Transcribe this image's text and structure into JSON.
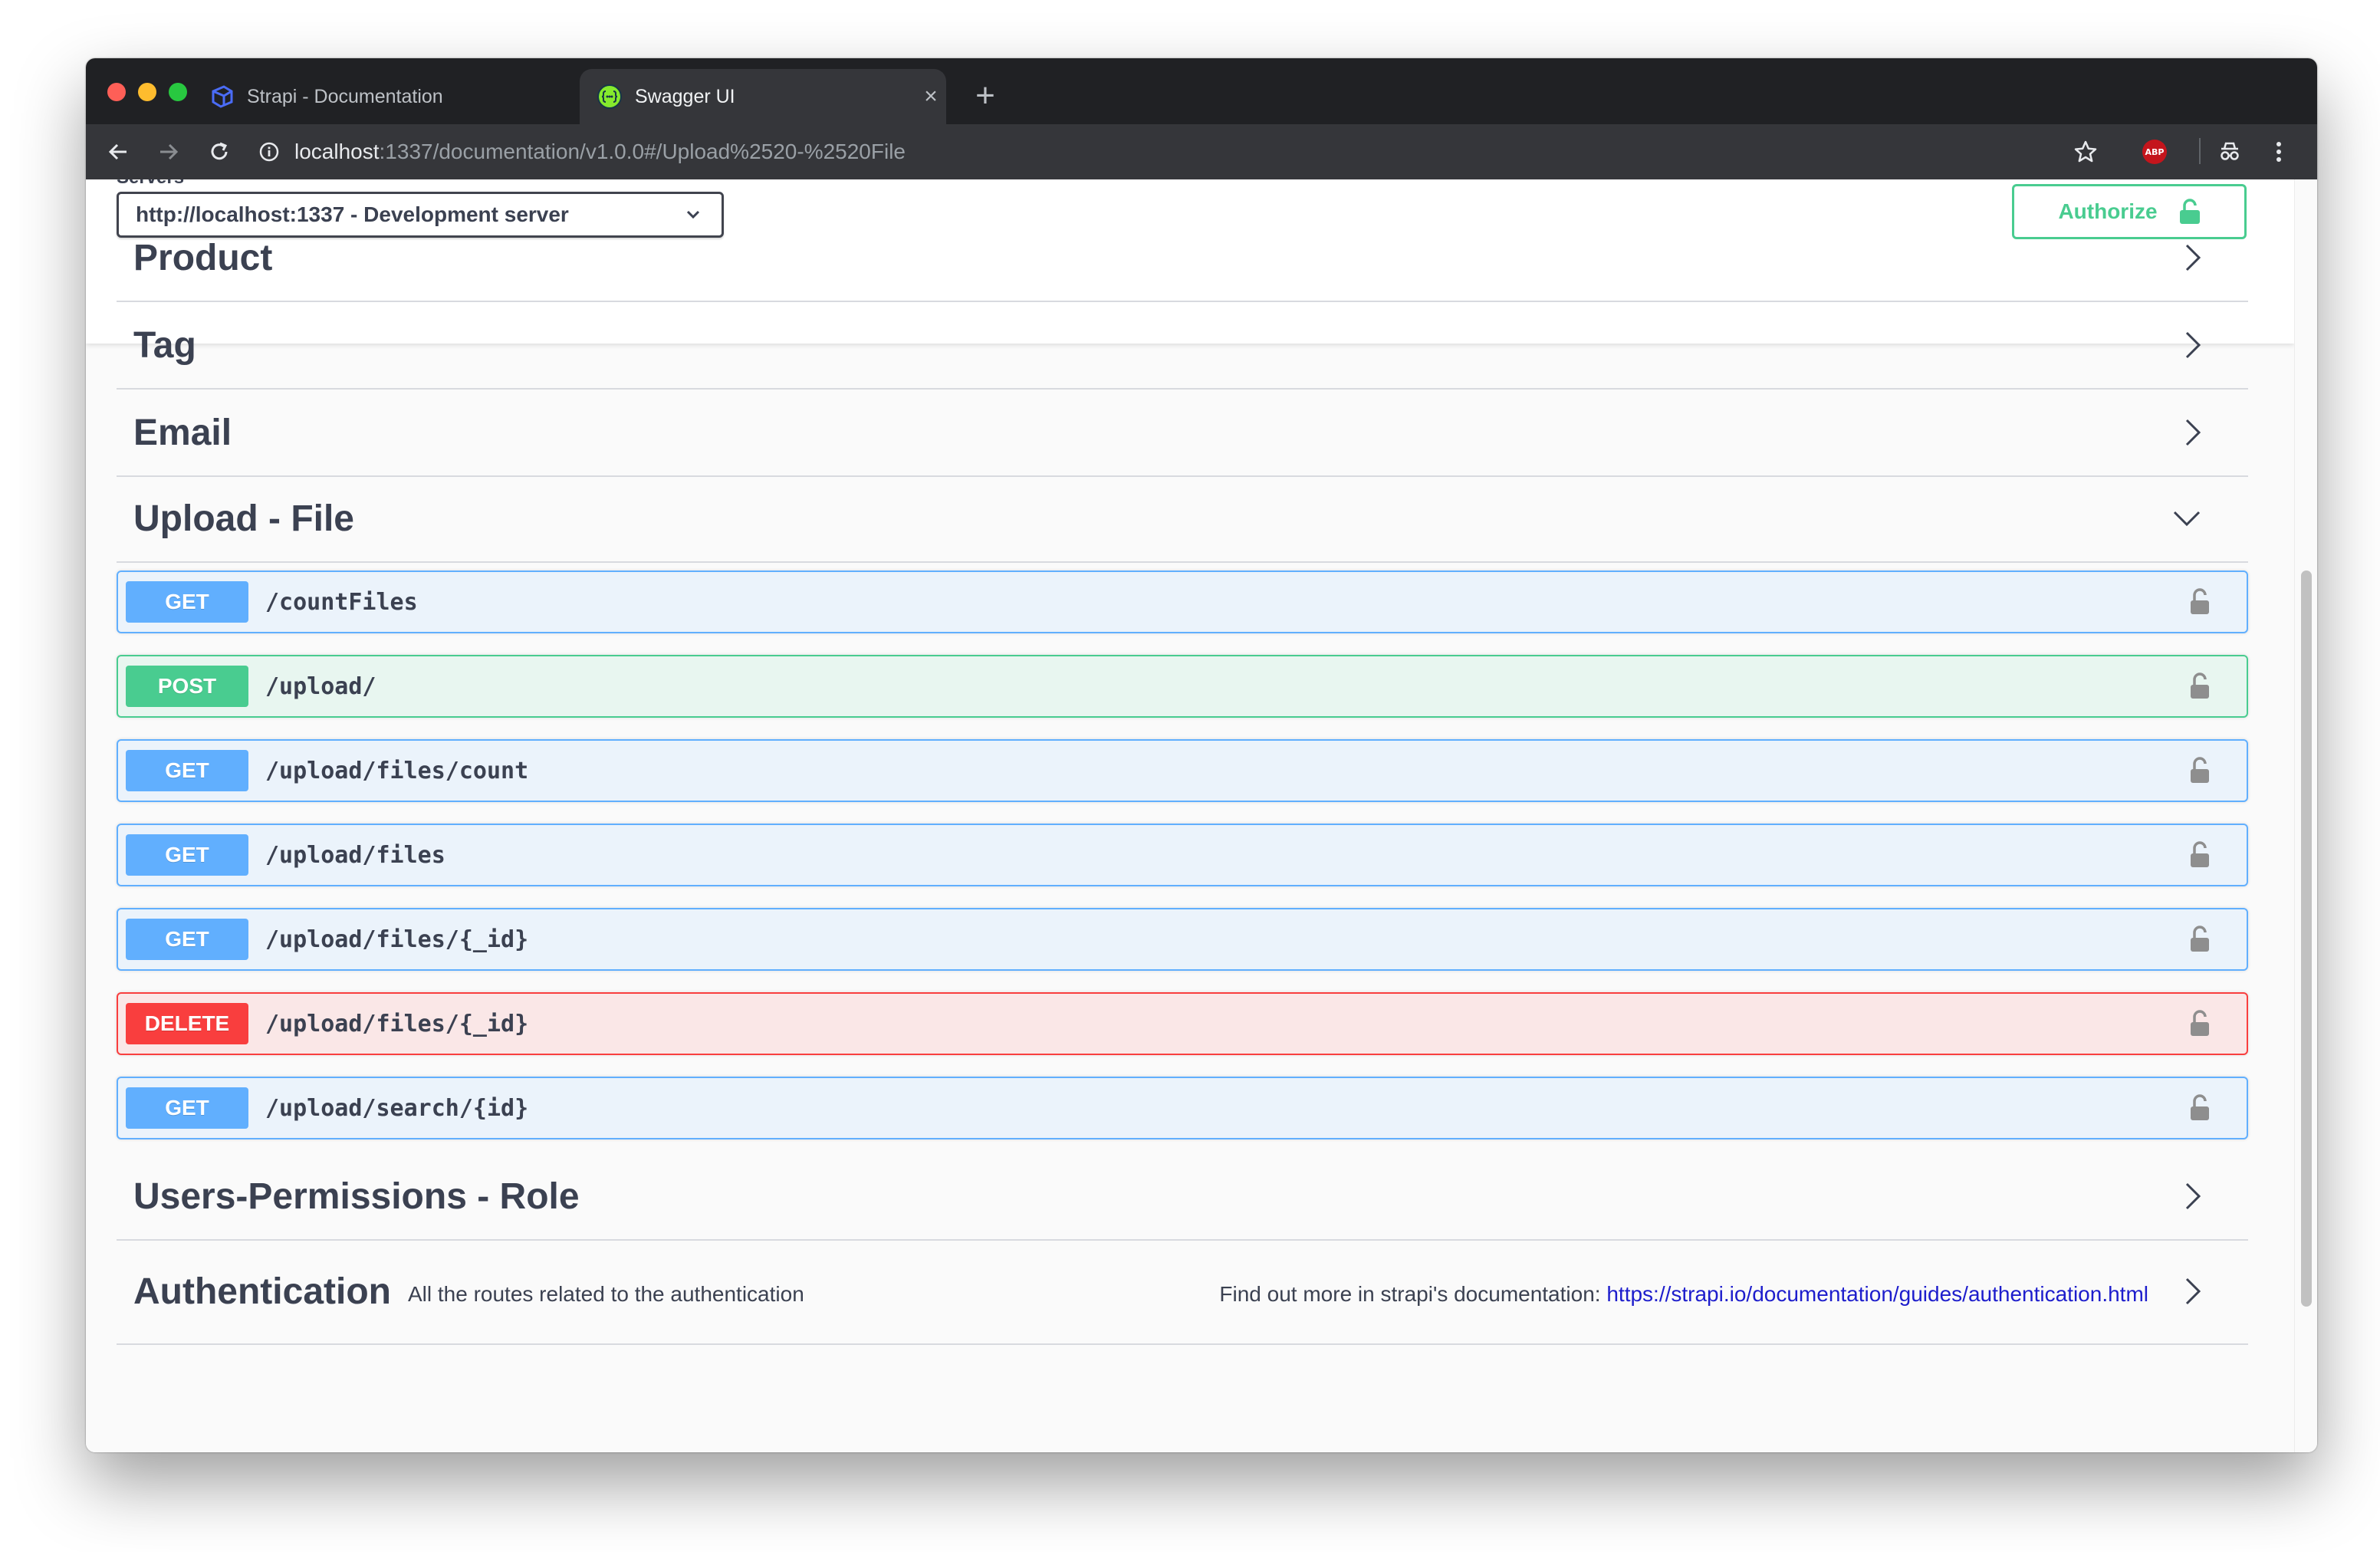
{
  "browser": {
    "tabs": [
      {
        "title": "Strapi - Documentation",
        "close": "×",
        "icon": "strapi-icon"
      },
      {
        "title": "Swagger UI",
        "close": "×",
        "icon": "swagger-icon"
      }
    ],
    "new_tab": "+",
    "url_host": "localhost",
    "url_rest": ":1337/documentation/v1.0.0#/Upload%2520-%2520File",
    "extension_abp": "ABP"
  },
  "servers": {
    "label": "Servers",
    "selected": "http://localhost:1337 - Development server"
  },
  "authorize": {
    "label": "Authorize"
  },
  "sections": {
    "product": "Product",
    "tag": "Tag",
    "email": "Email",
    "upload": "Upload - File",
    "users_permissions": "Users-Permissions - Role",
    "authentication": {
      "title": "Authentication",
      "description": "All the routes related to the authentication",
      "ext_text": "Find out more in strapi's documentation: ",
      "ext_link": "https://strapi.io/documentation/guides/authentication.html"
    }
  },
  "operations": [
    {
      "method": "GET",
      "path": "/countFiles"
    },
    {
      "method": "POST",
      "path": "/upload/"
    },
    {
      "method": "GET",
      "path": "/upload/files/count"
    },
    {
      "method": "GET",
      "path": "/upload/files"
    },
    {
      "method": "GET",
      "path": "/upload/files/{_id}"
    },
    {
      "method": "DELETE",
      "path": "/upload/files/{_id}"
    },
    {
      "method": "GET",
      "path": "/upload/search/{id}"
    }
  ],
  "colors": {
    "get": "#61affe",
    "post": "#49cc90",
    "delete": "#f93e3e",
    "text": "#3b4151",
    "link": "#1d1dcc"
  }
}
